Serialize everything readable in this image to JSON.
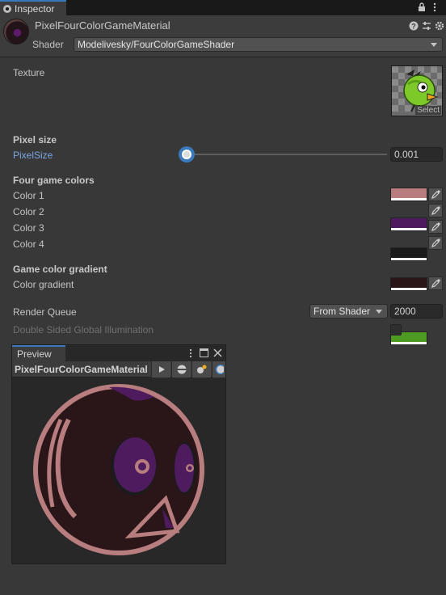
{
  "tab": {
    "label": "Inspector"
  },
  "header": {
    "material_name": "PixelFourColorGameMaterial",
    "shader_label": "Shader",
    "shader_value": "Modelivesky/FourColorGameShader"
  },
  "texture": {
    "label": "Texture",
    "select_label": "Select"
  },
  "pixel_section": {
    "title": "Pixel size",
    "param_label": "PixelSize",
    "value": "0.001",
    "slider_fraction": 0.0
  },
  "colors_section": {
    "title": "Four game colors",
    "items": [
      {
        "label": "Color 1",
        "color": "#b87d7e"
      },
      {
        "label": "Color 2",
        "color": "#4e1b5f"
      },
      {
        "label": "Color 3",
        "color": "#1b1b1b"
      },
      {
        "label": "Color 4",
        "color": "#2a1618"
      }
    ]
  },
  "gradient_section": {
    "title": "Game color gradient",
    "label": "Color gradient",
    "color": "#4e9b24"
  },
  "render_queue": {
    "label": "Render Queue",
    "dropdown": "From Shader",
    "value": "2000"
  },
  "dsgi": {
    "label": "Double Sided Global Illumination"
  },
  "preview": {
    "tab_label": "Preview",
    "object_name": "PixelFourColorGameMaterial"
  },
  "colors": {
    "accent": "#3a79bb",
    "link": "#7aa7e2",
    "panel": "#383838"
  }
}
